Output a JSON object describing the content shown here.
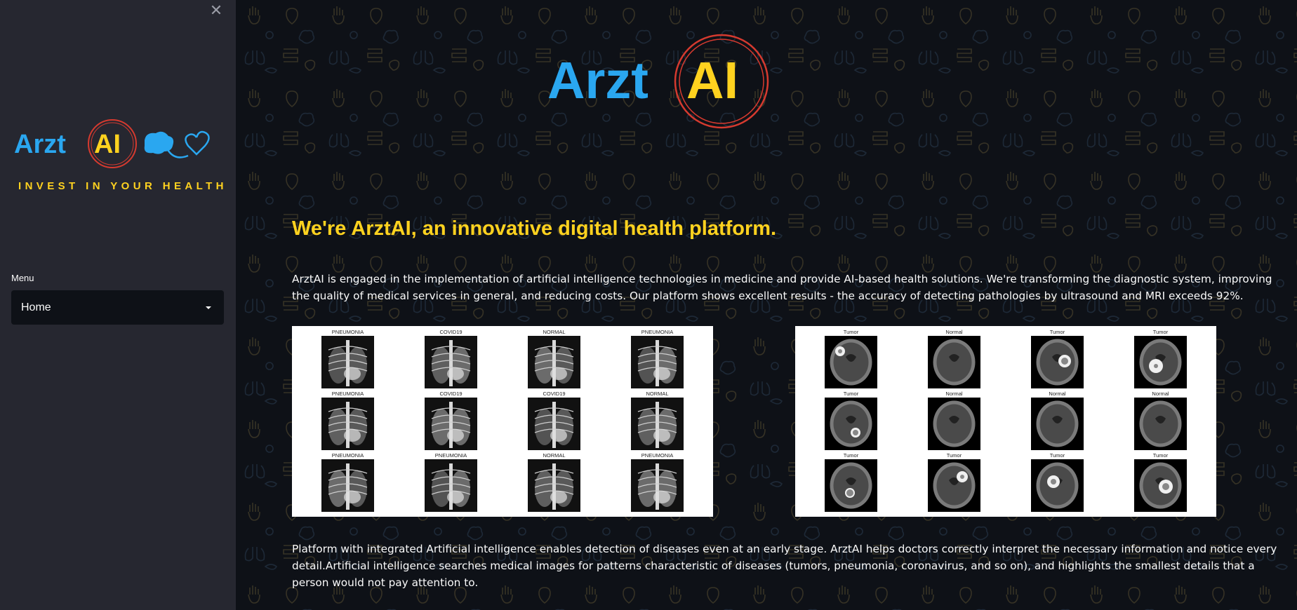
{
  "sidebar": {
    "close_icon": "close-icon",
    "logo": {
      "word1": "Arzt",
      "word2": "AI",
      "tagline": "INVEST IN YOUR HEALTH"
    },
    "menu_label": "Menu",
    "menu_selected": "Home"
  },
  "main": {
    "hero_logo": {
      "word1": "Arzt",
      "word2": "AI"
    },
    "headline": "We're ArztAI, an innovative digital health platform.",
    "paragraph1": "ArztAI is engaged in the implementation of artificial intelligence technologies in medicine and provide AI-based health solutions. We're transforming the diagnostic system, improving the quality of medical services in general, and reducing costs. Our platform shows excellent results - the accuracy of detecting pathologies by ultrasound and MRI exceeds 92%.",
    "xray_grid": [
      "PNEUMONIA",
      "COVID19",
      "NORMAL",
      "PNEUMONIA",
      "PNEUMONIA",
      "COVID19",
      "COVID19",
      "NORMAL",
      "PNEUMONIA",
      "PNEUMONIA",
      "NORMAL",
      "PNEUMONIA"
    ],
    "mri_grid": [
      "Tumor",
      "Normal",
      "Tumor",
      "Tumor",
      "Tumor",
      "Normal",
      "Normal",
      "Normal",
      "Tumor",
      "Tumor",
      "Tumor",
      "Tumor"
    ],
    "paragraph2": "Platform with integrated Artificial intelligence enables detection of diseases even at an early stage. ArztAI helps doctors correctly interpret the necessary information and notice every detail.Artificial intelligence searches medical images for patterns characteristic of diseases (tumors, pneumonia, coronavirus, and so on), and highlights the smallest details that a person would not pay attention to."
  },
  "colors": {
    "sidebar_bg": "#262730",
    "main_bg": "#0e1117",
    "accent_yellow": "#ffd21f",
    "logo_blue": "#2aa7f0",
    "logo_red": "#d63a2f"
  }
}
